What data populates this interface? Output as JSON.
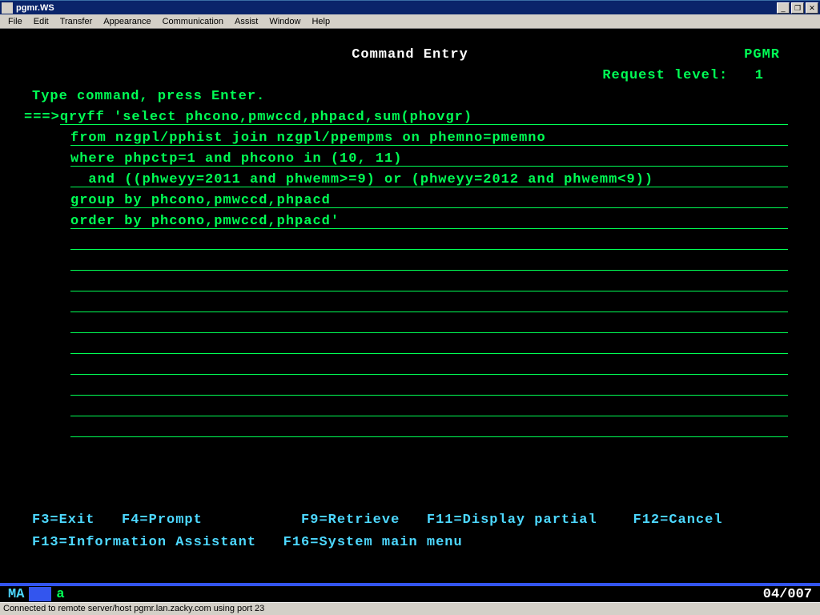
{
  "window": {
    "title": "pgmr.WS"
  },
  "menu": {
    "items": [
      "File",
      "Edit",
      "Transfer",
      "Appearance",
      "Communication",
      "Assist",
      "Window",
      "Help"
    ]
  },
  "screen": {
    "title": "Command Entry",
    "user": "PGMR",
    "request_label": "Request level:",
    "request_level": "1",
    "instruction": "Type command, press Enter.",
    "prompt": "===>",
    "command_lines": [
      "qryff 'select phcono,pmwccd,phpacd,sum(phovgr)",
      "from nzgpl/pphist join nzgpl/ppempms on phemno=pmemno",
      "where phpctp=1 and phcono in (10, 11)",
      "  and ((phweyy=2011 and phwemm>=9) or (phweyy=2012 and phwemm<9))",
      "group by phcono,pmwccd,phpacd",
      "order by phcono,pmwccd,phpacd'"
    ],
    "blank_lines": 10
  },
  "fkeys": {
    "row1": "F3=Exit   F4=Prompt           F9=Retrieve   F11=Display partial    F12=Cancel",
    "row2": "F13=Information Assistant   F16=System main menu"
  },
  "status_term": {
    "ma": "MA",
    "a": "a",
    "pos": "04/007"
  },
  "status_win": {
    "text": "Connected to remote server/host pgmr.lan.zacky.com using port 23"
  }
}
